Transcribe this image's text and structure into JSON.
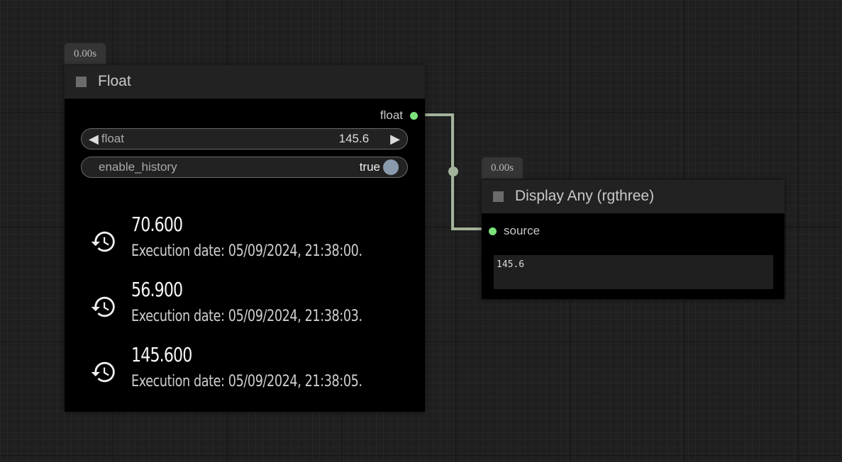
{
  "float_node": {
    "badge": "0.00s",
    "title": "Float",
    "output_label": "float",
    "float_widget": {
      "label": "float",
      "value": "145.6"
    },
    "history_widget": {
      "label": "enable_history",
      "value": "true"
    },
    "history": [
      {
        "value": "70.600",
        "date": "Execution date: 05/09/2024, 21:38:00."
      },
      {
        "value": "56.900",
        "date": "Execution date: 05/09/2024, 21:38:03."
      },
      {
        "value": "145.600",
        "date": "Execution date: 05/09/2024, 21:38:05."
      }
    ],
    "icons": {
      "collapse": "square-icon",
      "history": "history-icon",
      "decrement": "arrow-left-icon",
      "increment": "arrow-right-icon"
    }
  },
  "display_node": {
    "badge": "0.00s",
    "title": "Display Any (rgthree)",
    "input_label": "source",
    "output_text": "145.6"
  },
  "colors": {
    "slot_dot": "#7ce37c",
    "link": "#a3b39b",
    "toggle_knob": "#8a9bad"
  }
}
